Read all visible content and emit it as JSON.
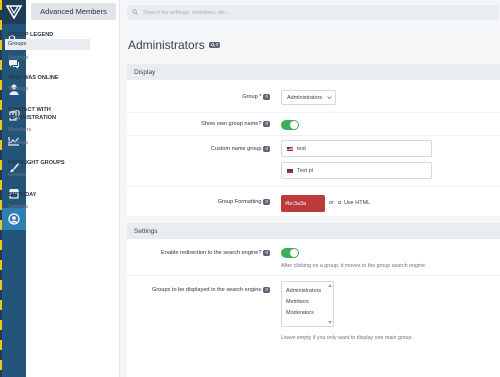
{
  "search": {
    "placeholder": "Search for settings, members, etc..."
  },
  "sidebar": {
    "header": "Advanced Members",
    "groups": [
      {
        "title": "GROUP LEGEND",
        "links": [
          "Groups",
          "Settings"
        ]
      },
      {
        "title": "WHO WAS ONLINE",
        "links": [
          "Settings"
        ]
      },
      {
        "title": "CONTACT WITH ADMINISTRATION",
        "links": [
          "Members",
          "Settings"
        ]
      },
      {
        "title": "HIGHLIGHT GROUPS",
        "links": [
          "Groups"
        ]
      },
      {
        "title": "BIRTHDAY",
        "links": [
          "Settings"
        ]
      }
    ]
  },
  "page": {
    "title": "Administrators",
    "badge": "0"
  },
  "display_section": {
    "title": "Display",
    "group_label": "Group *",
    "group_value": "Administrators",
    "show_own_label": "Show own group name?",
    "show_own_value": true,
    "custom_name_label": "Custom name group",
    "custom_name_values": [
      "test",
      "Test pl"
    ],
    "formatting_label": "Group Formatting",
    "formatting_value": "#bc3a3a",
    "or_text": "or",
    "use_html": "Use HTML"
  },
  "settings_section": {
    "title": "Settings",
    "redirect_label": "Enable redirection to the search engine?",
    "redirect_value": true,
    "redirect_help": "After clicking on a group, it moves to the group search engine.",
    "displayed_label": "Groups to be displayed in the search engine",
    "displayed_options": [
      "Administrators",
      "Members",
      "Moderators"
    ],
    "displayed_help": "Leave empty if you only want to display one main group."
  },
  "badges": {
    "zero": "0"
  },
  "colors": {
    "accent": "#2f7fb3",
    "toggle_on": "#3fae5a",
    "rail": "#23557a",
    "formatting": "#bc3a3a"
  }
}
